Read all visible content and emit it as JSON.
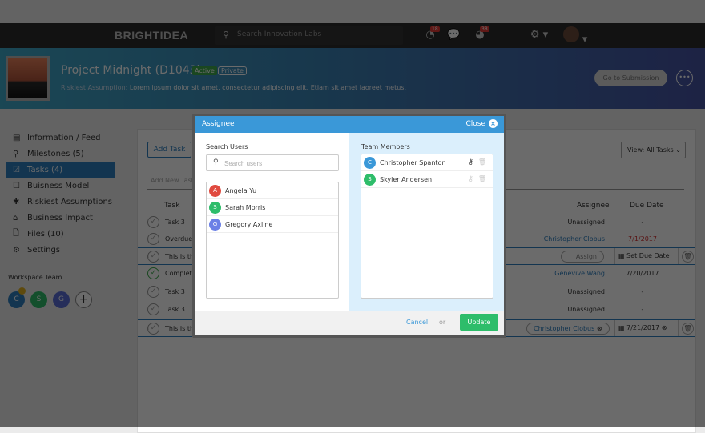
{
  "app": {
    "logo": "BRIGHTIDEA",
    "search_placeholder": "Search Innovation Labs",
    "notif_count_1": "18",
    "notif_count_2": "38"
  },
  "project": {
    "title": "Project Midnight (D1043)",
    "status": "Active",
    "visibility": "Private",
    "risk_label": "Riskiest Assumption:",
    "risk_text": "Lorem ipsum dolor sit amet, consectetur adipiscing elit. Etiam sit amet laoreet metus.",
    "go_button": "Go to Submission",
    "more_button": "•••"
  },
  "sidebar": {
    "items": [
      {
        "label": "Information / Feed",
        "icon": "▤"
      },
      {
        "label": "Milestones (5)",
        "icon": "⚲"
      },
      {
        "label": "Tasks (4)",
        "icon": "☑"
      },
      {
        "label": "Buisness Model",
        "icon": "☐"
      },
      {
        "label": "Riskiest Assumptions",
        "icon": "✱"
      },
      {
        "label": "Business Impact",
        "icon": "⌂"
      },
      {
        "label": "Files (10)",
        "icon": "🗋"
      },
      {
        "label": "Settings",
        "icon": "⚙"
      }
    ],
    "team_title": "Workspace Team",
    "team": [
      {
        "initial": "C",
        "color": "#2f7fbf"
      },
      {
        "initial": "S",
        "color": "#2ebd6a"
      },
      {
        "initial": "G",
        "color": "#5b6fd6"
      }
    ],
    "add": "+"
  },
  "tasks": {
    "add_button": "Add Task",
    "view_select": "View: All Tasks",
    "add_placeholder": "Add New Task",
    "headers": {
      "task": "Task",
      "assignee": "Assignee",
      "due": "Due Date"
    },
    "rows": [
      {
        "name": "Task 3",
        "assignee": "Unassigned",
        "due": "-"
      },
      {
        "name": "Overdue Task",
        "assignee": "Christopher Clobus",
        "due": "7/1/2017"
      },
      {
        "name": "This is the",
        "assignee": "Assign",
        "due": "Set Due Date"
      },
      {
        "name": "Complete",
        "assignee": "Genevive Wang",
        "due": "7/20/2017"
      },
      {
        "name": "Task 3",
        "assignee": "Unassigned",
        "due": "-"
      },
      {
        "name": "Task 3",
        "assignee": "Unassigned",
        "due": "-"
      },
      {
        "name": "This is the",
        "assignee": "Christopher Clobus",
        "due": "7/21/2017"
      }
    ]
  },
  "modal": {
    "title": "Assignee",
    "close": "Close",
    "search_label": "Search Users",
    "search_placeholder": "Search users",
    "users": [
      {
        "initial": "A",
        "name": "Angela Yu",
        "color": "#e04a3f"
      },
      {
        "initial": "S",
        "name": "Sarah Morris",
        "color": "#2ebd6a"
      },
      {
        "initial": "G",
        "name": "Gregory Axline",
        "color": "#6b80e6"
      }
    ],
    "members_label": "Team Members",
    "members": [
      {
        "initial": "C",
        "name": "Christopher Spanton",
        "color": "#3a98d8"
      },
      {
        "initial": "S",
        "name": "Skyler Andersen",
        "color": "#2ebd6a"
      }
    ],
    "cancel": "Cancel",
    "or": "or",
    "update": "Update"
  }
}
